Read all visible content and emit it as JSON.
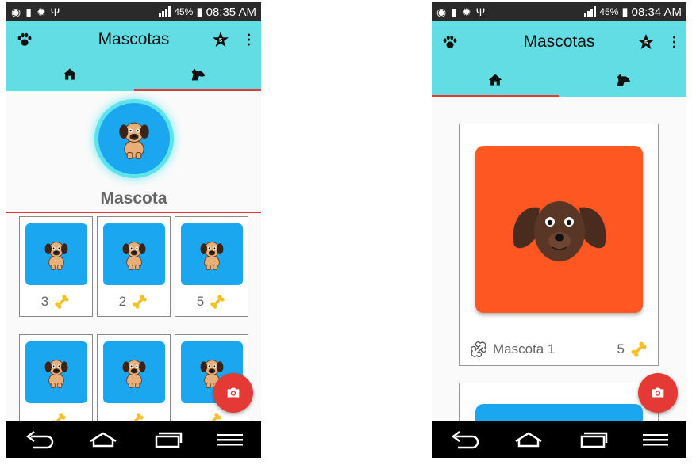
{
  "screen_left": {
    "status": {
      "pct": "45%",
      "time": "08:35 AM"
    },
    "app_title": "Mascotas",
    "star_badge": "5",
    "pet_name": "Mascota",
    "grid_likes": [
      "3",
      "2",
      "5",
      "",
      "",
      ""
    ]
  },
  "screen_right": {
    "status": {
      "pct": "45%",
      "time": "08:34 AM"
    },
    "app_title": "Mascotas",
    "star_badge": "5",
    "card": {
      "name": "Mascota 1",
      "likes": "5"
    }
  },
  "colors": {
    "accent": "#62dde3",
    "red": "#e53935",
    "pet_blue": "#1aa7f0",
    "pet_orange": "#ff5722",
    "bone": "#f3c12c"
  },
  "icons": [
    "paw-icon",
    "star-icon",
    "more-vert-icon",
    "home-icon",
    "dog-icon",
    "bone-icon",
    "camera-icon",
    "back-icon",
    "home-nav-icon",
    "recents-icon",
    "menu-icon"
  ]
}
